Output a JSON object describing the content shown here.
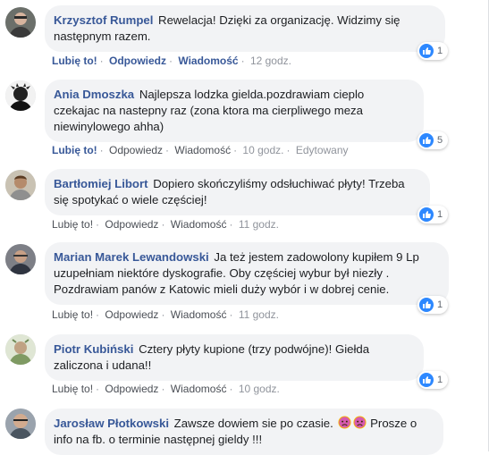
{
  "comments": [
    {
      "name": "Krzysztof Rumpel",
      "text": "Rewelacja! Dzięki za organizację. Widzimy się następnym razem.",
      "like": "Lubię to!",
      "reply": "Odpowiedz",
      "message": "Wiadomość",
      "time": "12 godz.",
      "reactions": "1"
    },
    {
      "name": "Ania Dmoszka",
      "text": "Najlepsza lodzka gielda.pozdrawiam cieplo czekajac na nastepny raz (zona ktora ma cierpliwego meza niewinylowego ahha)",
      "like": "Lubię to!",
      "reply": "Odpowiedz",
      "message": "Wiadomość",
      "time": "10 godz.",
      "edited": "Edytowany",
      "reactions": "5"
    },
    {
      "name": "Bartłomiej Libort",
      "text": "Dopiero skończyliśmy odsłuchiwać płyty! Trzeba się spotykać o wiele częściej!",
      "like": "Lubię to!",
      "reply": "Odpowiedz",
      "message": "Wiadomość",
      "time": "11 godz.",
      "reactions": "1"
    },
    {
      "name": "Marian Marek Lewandowski",
      "text": "Ja też jestem zadowolony kupiłem 9 Lp uzupełniam niektóre dyskografie. Oby częściej wybur był niezły . Pozdrawiam panów z Katowic mieli duży wybór i w dobrej cenie.",
      "like": "Lubię to!",
      "reply": "Odpowiedz",
      "message": "Wiadomość",
      "time": "11 godz.",
      "reactions": "1"
    },
    {
      "name": "Piotr Kubiński",
      "text": "Cztery płyty kupione (trzy podwójne)! Giełda zaliczona i udana!!",
      "like": "Lubię to!",
      "reply": "Odpowiedz",
      "message": "Wiadomość",
      "time": "10 godz.",
      "reactions": "1"
    },
    {
      "name": "Jarosław Płotkowski",
      "text": "Zawsze dowiem sie po czasie.",
      "text2": "Prosze o info na fb. o terminie następnej gieldy !!!"
    }
  ],
  "colors": {
    "name": "#385898",
    "bubble": "#f2f3f5",
    "meta": "#90949c",
    "like_blue": "#2d88ff"
  },
  "icons": [
    "like-thumb-icon",
    "worried-face-icon"
  ]
}
